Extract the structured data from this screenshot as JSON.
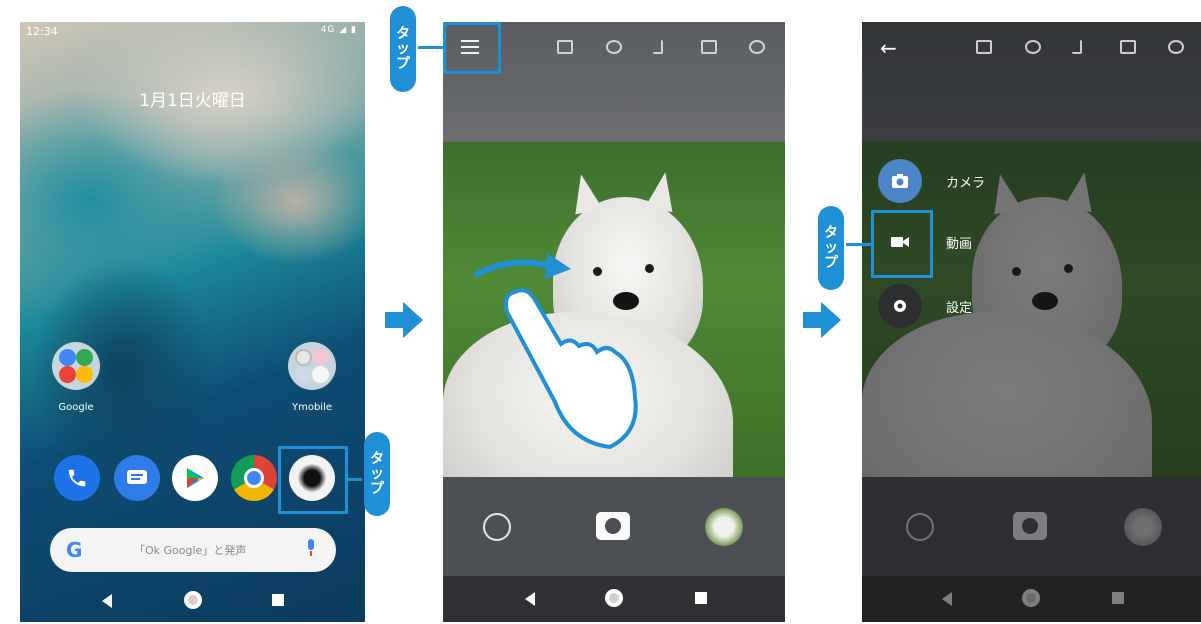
{
  "phone1": {
    "status_time": "12:34",
    "status_icons": "4G ◢ ▮",
    "date": "1月1日火曜日",
    "folders": [
      {
        "label": "Google"
      },
      {
        "label": "Ymobile"
      }
    ],
    "dock_apps": [
      "phone-icon",
      "messages-icon",
      "play-store-icon",
      "chrome-icon",
      "camera-icon"
    ],
    "search": {
      "g": "G",
      "placeholder": "「Ok Google」と発声"
    },
    "tap_badge": [
      "タ",
      "ッ",
      "プ"
    ]
  },
  "phone2": {
    "toolbar_icons": [
      "menu-icon",
      "focus-icon",
      "hdr-icon",
      "flash-icon",
      "exposure-icon",
      "timer-icon"
    ],
    "tap_badge": [
      "タ",
      "ッ",
      "プ"
    ]
  },
  "phone3": {
    "menu": [
      {
        "label": "カメラ",
        "icon": "camera-icon"
      },
      {
        "label": "動画",
        "icon": "video-icon"
      },
      {
        "label": "設定",
        "icon": "settings-icon"
      }
    ],
    "tap_badge": [
      "タ",
      "ッ",
      "プ"
    ]
  },
  "colors": {
    "accent": "#1f8fd6",
    "camera_menu_bg": "#4a86c8"
  }
}
